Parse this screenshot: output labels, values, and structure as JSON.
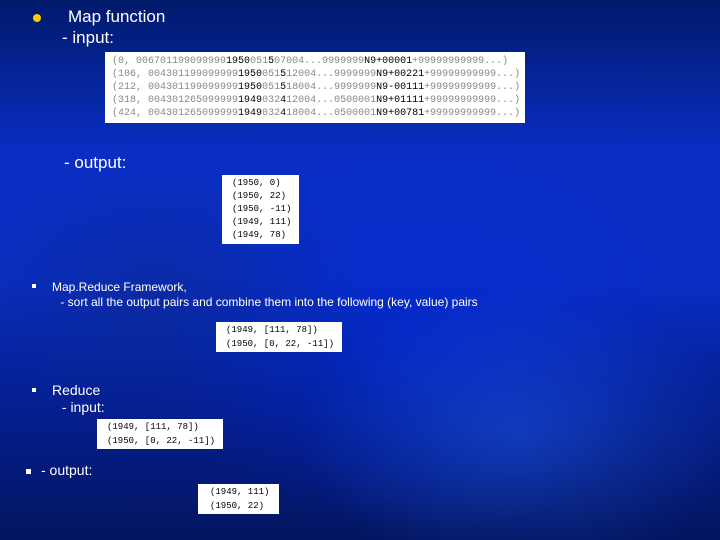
{
  "map": {
    "title": "Map function",
    "input_label": "- input:",
    "output_label": "- output:",
    "input_rows": [
      {
        "off": "(0,",
        "rec": "006701199099999",
        "yr": "1950",
        "a": "051",
        "b": "5",
        "mid": "07004...9999999",
        "tag": "N9",
        "c": "+00001",
        "tail": "+99999999999...)"
      },
      {
        "off": "(106,",
        "rec": "004301199099999",
        "yr": "1950",
        "a": "051",
        "b": "5",
        "mid": "12004...9999999",
        "tag": "N9",
        "c": "+00221",
        "tail": "+99999999999...)"
      },
      {
        "off": "(212,",
        "rec": "004301199099999",
        "yr": "1950",
        "a": "051",
        "b": "5",
        "mid": "18004...9999999",
        "tag": "N9",
        "c": "-00111",
        "tail": "+99999999999...)"
      },
      {
        "off": "(318,",
        "rec": "004301265099999",
        "yr": "1949",
        "a": "032",
        "b": "4",
        "mid": "12004...0500001",
        "tag": "N9",
        "c": "+01111",
        "tail": "+99999999999...)"
      },
      {
        "off": "(424,",
        "rec": "004301265099999",
        "yr": "1949",
        "a": "032",
        "b": "4",
        "mid": "18004...0500001",
        "tag": "N9",
        "c": "+00781",
        "tail": "+99999999999...)"
      }
    ],
    "output_rows": [
      "(1950, 0)",
      "(1950, 22)",
      "(1950, -11)",
      "(1949, 111)",
      "(1949, 78)"
    ]
  },
  "framework": {
    "title": "Map.Reduce Framework,",
    "desc": " - sort all the output pairs and combine them into the following (key, value) pairs",
    "rows": [
      "(1949, [111, 78])",
      "(1950, [0, 22, -11])"
    ]
  },
  "reduce": {
    "title": "Reduce",
    "input_label": " - input:",
    "input_rows": [
      "(1949, [111, 78])",
      "(1950, [0, 22, -11])"
    ],
    "output_label": "- output:",
    "output_rows": [
      "(1949, 111)",
      "(1950, 22)"
    ]
  },
  "chart_data": {
    "type": "table",
    "title": "MapReduce example: max temperature by year",
    "map_input": [
      {
        "offset": 0,
        "year": 1950,
        "temp": 1
      },
      {
        "offset": 106,
        "year": 1950,
        "temp": 22
      },
      {
        "offset": 212,
        "year": 1950,
        "temp": -11
      },
      {
        "offset": 318,
        "year": 1949,
        "temp": 111
      },
      {
        "offset": 424,
        "year": 1949,
        "temp": 78
      }
    ],
    "map_output": [
      [
        1950,
        0
      ],
      [
        1950,
        22
      ],
      [
        1950,
        -11
      ],
      [
        1949,
        111
      ],
      [
        1949,
        78
      ]
    ],
    "shuffle_output": {
      "1949": [
        111,
        78
      ],
      "1950": [
        0,
        22,
        -11
      ]
    },
    "reduce_output": {
      "1949": 111,
      "1950": 22
    }
  }
}
